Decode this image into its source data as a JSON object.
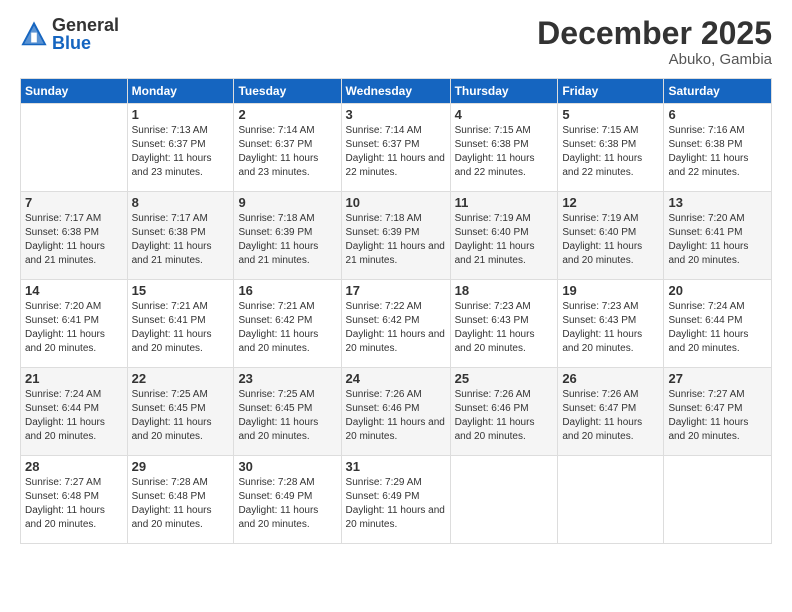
{
  "header": {
    "logo_general": "General",
    "logo_blue": "Blue",
    "month_title": "December 2025",
    "location": "Abuko, Gambia"
  },
  "weekdays": [
    "Sunday",
    "Monday",
    "Tuesday",
    "Wednesday",
    "Thursday",
    "Friday",
    "Saturday"
  ],
  "weeks": [
    [
      {
        "day": "",
        "sunrise": "",
        "sunset": "",
        "daylight": ""
      },
      {
        "day": "1",
        "sunrise": "7:13 AM",
        "sunset": "6:37 PM",
        "daylight": "11 hours and 23 minutes."
      },
      {
        "day": "2",
        "sunrise": "7:14 AM",
        "sunset": "6:37 PM",
        "daylight": "11 hours and 23 minutes."
      },
      {
        "day": "3",
        "sunrise": "7:14 AM",
        "sunset": "6:37 PM",
        "daylight": "11 hours and 22 minutes."
      },
      {
        "day": "4",
        "sunrise": "7:15 AM",
        "sunset": "6:38 PM",
        "daylight": "11 hours and 22 minutes."
      },
      {
        "day": "5",
        "sunrise": "7:15 AM",
        "sunset": "6:38 PM",
        "daylight": "11 hours and 22 minutes."
      },
      {
        "day": "6",
        "sunrise": "7:16 AM",
        "sunset": "6:38 PM",
        "daylight": "11 hours and 22 minutes."
      }
    ],
    [
      {
        "day": "7",
        "sunrise": "7:17 AM",
        "sunset": "6:38 PM",
        "daylight": "11 hours and 21 minutes."
      },
      {
        "day": "8",
        "sunrise": "7:17 AM",
        "sunset": "6:38 PM",
        "daylight": "11 hours and 21 minutes."
      },
      {
        "day": "9",
        "sunrise": "7:18 AM",
        "sunset": "6:39 PM",
        "daylight": "11 hours and 21 minutes."
      },
      {
        "day": "10",
        "sunrise": "7:18 AM",
        "sunset": "6:39 PM",
        "daylight": "11 hours and 21 minutes."
      },
      {
        "day": "11",
        "sunrise": "7:19 AM",
        "sunset": "6:40 PM",
        "daylight": "11 hours and 21 minutes."
      },
      {
        "day": "12",
        "sunrise": "7:19 AM",
        "sunset": "6:40 PM",
        "daylight": "11 hours and 20 minutes."
      },
      {
        "day": "13",
        "sunrise": "7:20 AM",
        "sunset": "6:41 PM",
        "daylight": "11 hours and 20 minutes."
      }
    ],
    [
      {
        "day": "14",
        "sunrise": "7:20 AM",
        "sunset": "6:41 PM",
        "daylight": "11 hours and 20 minutes."
      },
      {
        "day": "15",
        "sunrise": "7:21 AM",
        "sunset": "6:41 PM",
        "daylight": "11 hours and 20 minutes."
      },
      {
        "day": "16",
        "sunrise": "7:21 AM",
        "sunset": "6:42 PM",
        "daylight": "11 hours and 20 minutes."
      },
      {
        "day": "17",
        "sunrise": "7:22 AM",
        "sunset": "6:42 PM",
        "daylight": "11 hours and 20 minutes."
      },
      {
        "day": "18",
        "sunrise": "7:23 AM",
        "sunset": "6:43 PM",
        "daylight": "11 hours and 20 minutes."
      },
      {
        "day": "19",
        "sunrise": "7:23 AM",
        "sunset": "6:43 PM",
        "daylight": "11 hours and 20 minutes."
      },
      {
        "day": "20",
        "sunrise": "7:24 AM",
        "sunset": "6:44 PM",
        "daylight": "11 hours and 20 minutes."
      }
    ],
    [
      {
        "day": "21",
        "sunrise": "7:24 AM",
        "sunset": "6:44 PM",
        "daylight": "11 hours and 20 minutes."
      },
      {
        "day": "22",
        "sunrise": "7:25 AM",
        "sunset": "6:45 PM",
        "daylight": "11 hours and 20 minutes."
      },
      {
        "day": "23",
        "sunrise": "7:25 AM",
        "sunset": "6:45 PM",
        "daylight": "11 hours and 20 minutes."
      },
      {
        "day": "24",
        "sunrise": "7:26 AM",
        "sunset": "6:46 PM",
        "daylight": "11 hours and 20 minutes."
      },
      {
        "day": "25",
        "sunrise": "7:26 AM",
        "sunset": "6:46 PM",
        "daylight": "11 hours and 20 minutes."
      },
      {
        "day": "26",
        "sunrise": "7:26 AM",
        "sunset": "6:47 PM",
        "daylight": "11 hours and 20 minutes."
      },
      {
        "day": "27",
        "sunrise": "7:27 AM",
        "sunset": "6:47 PM",
        "daylight": "11 hours and 20 minutes."
      }
    ],
    [
      {
        "day": "28",
        "sunrise": "7:27 AM",
        "sunset": "6:48 PM",
        "daylight": "11 hours and 20 minutes."
      },
      {
        "day": "29",
        "sunrise": "7:28 AM",
        "sunset": "6:48 PM",
        "daylight": "11 hours and 20 minutes."
      },
      {
        "day": "30",
        "sunrise": "7:28 AM",
        "sunset": "6:49 PM",
        "daylight": "11 hours and 20 minutes."
      },
      {
        "day": "31",
        "sunrise": "7:29 AM",
        "sunset": "6:49 PM",
        "daylight": "11 hours and 20 minutes."
      },
      {
        "day": "",
        "sunrise": "",
        "sunset": "",
        "daylight": ""
      },
      {
        "day": "",
        "sunrise": "",
        "sunset": "",
        "daylight": ""
      },
      {
        "day": "",
        "sunrise": "",
        "sunset": "",
        "daylight": ""
      }
    ]
  ]
}
